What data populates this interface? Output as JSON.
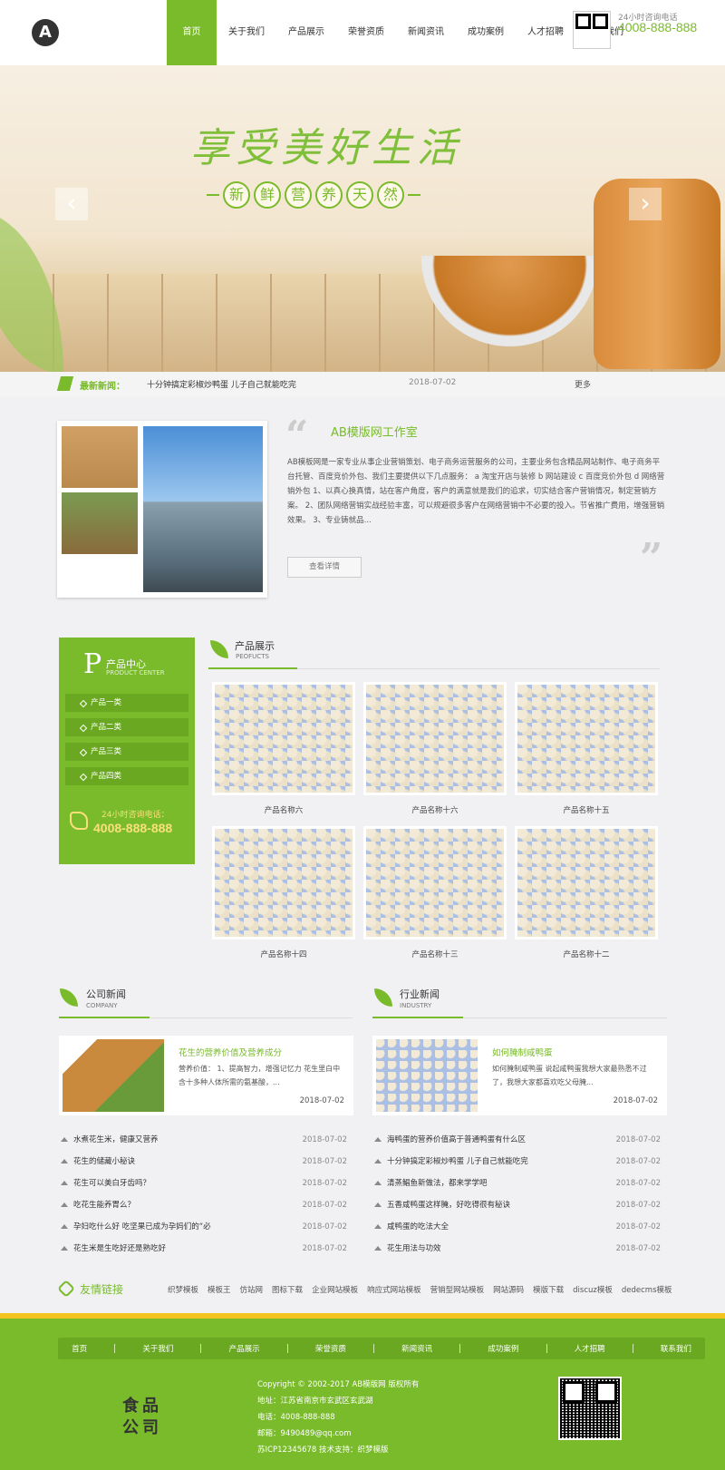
{
  "header": {
    "logo": "A",
    "nav": [
      "首页",
      "关于我们",
      "产品展示",
      "荣誉资质",
      "新闻资讯",
      "成功案例",
      "人才招聘",
      "联系我们"
    ],
    "hotline_label": "24小时咨询电话",
    "hotline": "4008-888-888"
  },
  "banner": {
    "title": "享受美好生活",
    "subtitle_chars": [
      "新",
      "鲜",
      "营",
      "养",
      "天",
      "然"
    ],
    "prev": "‹",
    "next": "›"
  },
  "ticker": {
    "label": "最新新闻：",
    "text": "十分钟搞定彩椒炒鸭蛋 儿子自己就能吃完",
    "date": "2018-07-02",
    "more": "更多"
  },
  "about": {
    "quote_open": "“",
    "quote_close": "”",
    "title": "AB模版网工作室",
    "text": "AB模板网是一家专业从事企业营销策划、电子商务运营服务的公司，主要业务包含精品网站制作、电子商务平台托管、百度竞价外包、我们主要提供以下几点服务： a 淘宝开店与装修 b 网站建设 c 百度竞价外包 d 网络营销外包 1、以真心换真情，站在客户角度，客户的满意就是我们的追求，切实结合客户营销情况，制定营销方案。 2、团队网络营销实战经验丰富，可以规避很多客户在网络营销中不必要的投入。节省推广费用，增强营销效果。 3、专业铸就品...",
    "button": "查看详情"
  },
  "product_sidebar": {
    "letter": "P",
    "title": "产品中心",
    "en": "PRODUCT CENTER",
    "categories": [
      "产品一类",
      "产品二类",
      "产品三类",
      "产品四类"
    ],
    "phone_label": "24小时咨询电话：",
    "phone": "4008-888-888"
  },
  "products": {
    "title": "产品展示",
    "en": "PEOFUCTS",
    "items": [
      "产品名称六",
      "产品名称十六",
      "产品名称十五",
      "产品名称十四",
      "产品名称十三",
      "产品名称十二"
    ]
  },
  "company_news": {
    "title": "公司新闻",
    "en": "COMPANY",
    "featured": {
      "title": "花生的营养价值及营养成分",
      "text": "营养价值： 1、提高智力，增强记忆力 花生里白中含十多种人体所需的氨基酸，...",
      "date": "2018-07-02"
    },
    "list": [
      {
        "title": "水煮花生米，健康又营养",
        "date": "2018-07-02"
      },
      {
        "title": "花生的储藏小秘诀",
        "date": "2018-07-02"
      },
      {
        "title": "花生可以美白牙齿吗？",
        "date": "2018-07-02"
      },
      {
        "title": "吃花生能养胃么？",
        "date": "2018-07-02"
      },
      {
        "title": "孕妇吃什么好 吃坚果已成为孕妈们的“必",
        "date": "2018-07-02"
      },
      {
        "title": "花生米是生吃好还是熟吃好",
        "date": "2018-07-02"
      }
    ]
  },
  "industry_news": {
    "title": "行业新闻",
    "en": "INDUSTRY",
    "featured": {
      "title": "如何腌制咸鸭蛋",
      "text": "如何腌制咸鸭蛋 说起咸鸭蛋我想大家最熟悉不过了，我想大家都喜欢吃父母腌...",
      "date": "2018-07-02"
    },
    "list": [
      {
        "title": "海鸭蛋的营养价值高于普通鸭蛋有什么区",
        "date": "2018-07-02"
      },
      {
        "title": "十分钟搞定彩椒炒鸭蛋 儿子自己就能吃完",
        "date": "2018-07-02"
      },
      {
        "title": "清蒸鲳鱼新做法，都来学学吧",
        "date": "2018-07-02"
      },
      {
        "title": "五香咸鸭蛋这样腌，好吃得很有秘诀",
        "date": "2018-07-02"
      },
      {
        "title": "咸鸭蛋的吃法大全",
        "date": "2018-07-02"
      },
      {
        "title": "花生用法与功效",
        "date": "2018-07-02"
      }
    ]
  },
  "links": {
    "title": "友情链接",
    "items": [
      "织梦模板",
      "模板王",
      "仿站网",
      "图标下载",
      "企业网站模板",
      "响应式网站模板",
      "营销型网站模板",
      "网站源码",
      "模版下载",
      "discuz模板",
      "dedecms模板"
    ]
  },
  "footer": {
    "nav": [
      "首页",
      "关于我们",
      "产品展示",
      "荣誉资质",
      "新闻资讯",
      "成功案例",
      "人才招聘",
      "联系我们"
    ],
    "logo_line1": "食品",
    "logo_line2": "公司",
    "copyright": "Copyright © 2002-2017 AB模版网 版权所有",
    "address": "地址：江苏省南京市玄武区玄武湖",
    "phone": "电话：4008-888-888",
    "email": "邮箱：9490489@qq.com",
    "icp": "苏ICP12345678  技术支持：织梦模版"
  },
  "colors": {
    "accent": "#79bb2b",
    "accent_dark": "#6aa822",
    "phone_yellow": "#f9e07a",
    "footer_bar": "#f3c41f"
  }
}
